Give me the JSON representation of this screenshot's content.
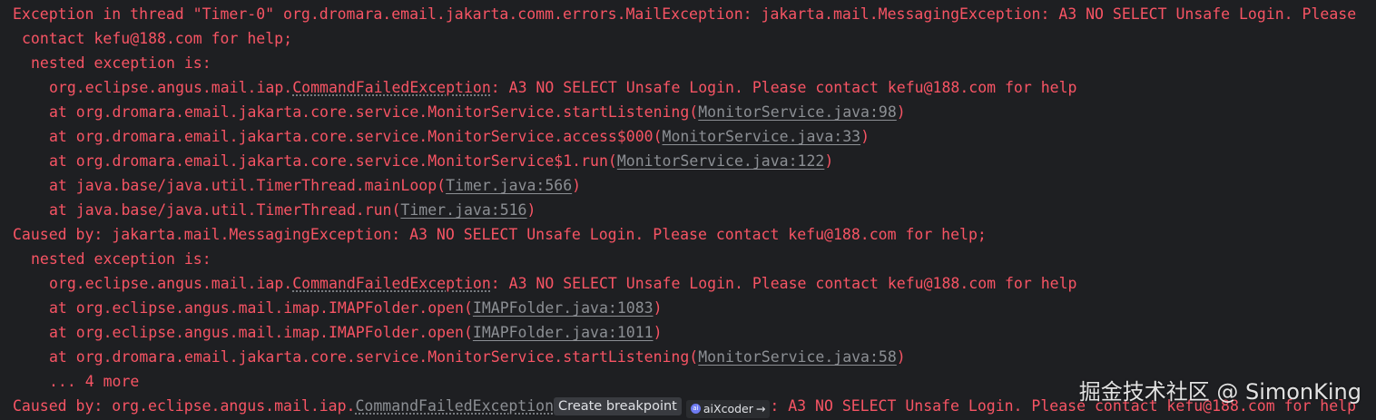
{
  "console": {
    "lines": [
      {
        "kind": "plain",
        "indent": 0,
        "text": "Exception in thread \"Timer-0\" org.dromara.email.jakarta.comm.errors.MailException: jakarta.mail.MessagingException: A3 NO SELECT Unsafe Login. Please"
      },
      {
        "kind": "plain",
        "indent": 1,
        "text": "contact kefu@188.com for help;"
      },
      {
        "kind": "plain",
        "indent": 2,
        "text": "nested exception is:"
      },
      {
        "kind": "exc",
        "indent": 3,
        "prefix": "org.eclipse.angus.mail.iap.",
        "cls": "CommandFailedException",
        "suffix": ": A3 NO SELECT Unsafe Login. Please contact kefu@188.com for help"
      },
      {
        "kind": "frame",
        "indent": 3,
        "prefix": "at org.dromara.email.jakarta.core.service.MonitorService.startListening(",
        "link": "MonitorService.java:98",
        "suffix": ")"
      },
      {
        "kind": "frame",
        "indent": 3,
        "prefix": "at org.dromara.email.jakarta.core.service.MonitorService.access$000(",
        "link": "MonitorService.java:33",
        "suffix": ")"
      },
      {
        "kind": "frame",
        "indent": 3,
        "prefix": "at org.dromara.email.jakarta.core.service.MonitorService$1.run(",
        "link": "MonitorService.java:122",
        "suffix": ")"
      },
      {
        "kind": "frame",
        "indent": 3,
        "prefix": "at java.base/java.util.TimerThread.mainLoop(",
        "link": "Timer.java:566",
        "suffix": ")"
      },
      {
        "kind": "frame",
        "indent": 3,
        "prefix": "at java.base/java.util.TimerThread.run(",
        "link": "Timer.java:516",
        "suffix": ")"
      },
      {
        "kind": "plain",
        "indent": 0,
        "text": "Caused by: jakarta.mail.MessagingException: A3 NO SELECT Unsafe Login. Please contact kefu@188.com for help;"
      },
      {
        "kind": "plain",
        "indent": 2,
        "text": "nested exception is:"
      },
      {
        "kind": "exc",
        "indent": 3,
        "prefix": "org.eclipse.angus.mail.iap.",
        "cls": "CommandFailedException",
        "suffix": ": A3 NO SELECT Unsafe Login. Please contact kefu@188.com for help"
      },
      {
        "kind": "frame",
        "indent": 3,
        "prefix": "at org.eclipse.angus.mail.imap.IMAPFolder.open(",
        "link": "IMAPFolder.java:1083",
        "suffix": ")"
      },
      {
        "kind": "frame",
        "indent": 3,
        "prefix": "at org.eclipse.angus.mail.imap.IMAPFolder.open(",
        "link": "IMAPFolder.java:1011",
        "suffix": ")"
      },
      {
        "kind": "frame",
        "indent": 3,
        "prefix": "at org.dromara.email.jakarta.core.service.MonitorService.startListening(",
        "link": "MonitorService.java:58",
        "suffix": ")"
      },
      {
        "kind": "plain",
        "indent": 3,
        "text": "... 4 more"
      }
    ],
    "last_line": {
      "prefix": "Caused by: org.eclipse.angus.mail.iap.",
      "cls": "CommandFailedException",
      "hint_label": "Create breakpoint",
      "ai_label": "aiXcoder",
      "ai_arrow": "→",
      "suffix": ": A3 NO SELECT Unsafe Login. Please contact kefu@188.com for help"
    }
  },
  "watermark": {
    "text": "掘金技术社区 @ SimonKing"
  },
  "colors": {
    "background": "#1e1f22",
    "error_text": "#f75464",
    "link_text": "#8c8f94",
    "hint_bg": "#393b40"
  }
}
